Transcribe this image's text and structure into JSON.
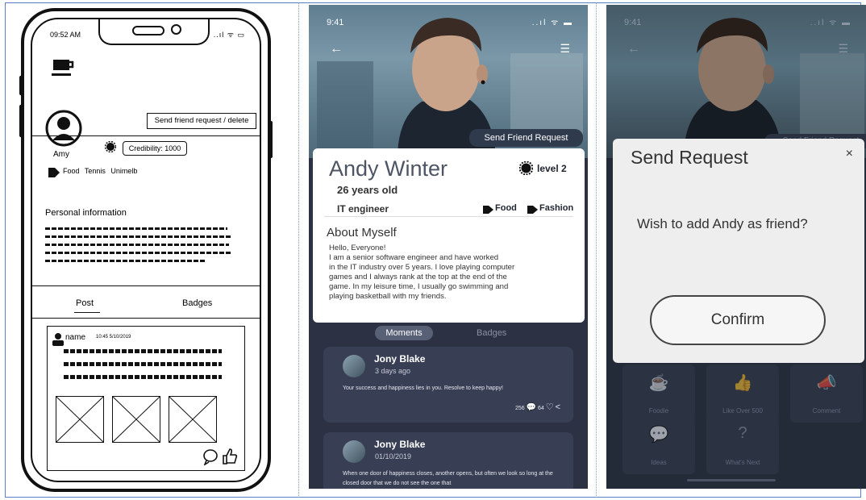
{
  "wireframe": {
    "time": "09:52 AM",
    "status_icons": "..ıl ᯤ ▭",
    "send_button": "Send friend request / delete",
    "user_name": "Amy",
    "credibility": "Credibility: 1000",
    "tags": "Food  Tennis  Unimelb",
    "personal_info_title": "Personal information",
    "tab_post": "Post",
    "tab_badges": "Badges",
    "post_user": "name",
    "post_time": "10:45 5/10/2019"
  },
  "profile": {
    "time": "9:41",
    "status_icons": "..ıl ᯤ ▬",
    "send_friend_request": "Send Friend Request",
    "name": "Andy Winter",
    "level": "level 2",
    "age": "26 years old",
    "job": "IT engineer",
    "tags": [
      "Food",
      "Fashion"
    ],
    "about_title": "About Myself",
    "about_text": "Hello, Everyone!\nI am a senior software engineer and have worked\nin the IT industry over 5 years. I love playing computer\ngames and I always rank at the top at the end of the\ngame. In my leisure time, I usually go swimming and\nplaying basketball with my friends.",
    "tab_moments": "Moments",
    "tab_badges": "Badges",
    "moments": [
      {
        "name": "Jony Blake",
        "date": "3 days ago",
        "text": "Your success and happiness lies in you. Resolve to keep happy!",
        "comments": "256",
        "likes": "64"
      },
      {
        "name": "Jony Blake",
        "date": "01/10/2019",
        "text": "When one door of happiness closes, another opens, but often we look so long at the closed door that we do not see the one that"
      }
    ]
  },
  "dialog_screen": {
    "time": "9:41",
    "status_icons": "..ıl ᯤ ▬",
    "send_friend_request": "Send Friend Request",
    "dialog_title": "Send Request",
    "close": "×",
    "message": "Wish to add Andy as friend?",
    "confirm": "Confirm",
    "badges": [
      {
        "label": "Foodie",
        "icon": "☕"
      },
      {
        "label": "Like Over 500",
        "icon": "👍"
      },
      {
        "label": "Comment",
        "icon": "📣"
      },
      {
        "label": "Ideas",
        "icon": "💬"
      },
      {
        "label": "What's Next",
        "icon": "?"
      }
    ]
  }
}
